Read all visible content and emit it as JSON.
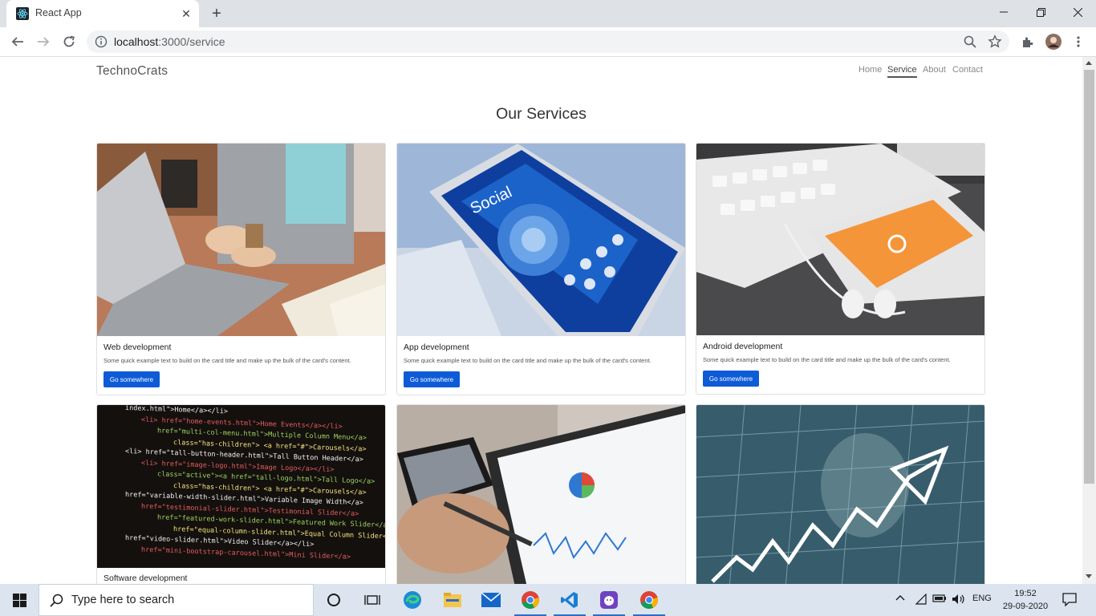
{
  "browser": {
    "tab_title": "React App",
    "url_host": "localhost",
    "url_path": ":3000/service",
    "window_controls": [
      "minimize-icon",
      "restore-icon",
      "close-icon"
    ]
  },
  "page": {
    "brand": "TechnoCrats",
    "nav": [
      {
        "label": "Home",
        "active": false
      },
      {
        "label": "Service",
        "active": true
      },
      {
        "label": "About",
        "active": false
      },
      {
        "label": "Contact",
        "active": false
      }
    ],
    "heading": "Our Services",
    "cards": [
      {
        "title": "Web development",
        "text": "Some quick example text to build on the card title and make up the bulk of the card's content.",
        "button": "Go somewhere",
        "image": "laptop-typing-photo"
      },
      {
        "title": "App development",
        "text": "Some quick example text to build on the card title and make up the bulk of the card's content.",
        "button": "Go somewhere",
        "image": "social-phone-photo"
      },
      {
        "title": "Android development",
        "text": "Some quick example text to build on the card title and make up the bulk of the card's content.",
        "button": "Go somewhere",
        "image": "android-phone-keyboard-photo"
      },
      {
        "title": "Software development",
        "text": "",
        "button": "",
        "image": "code-screen-photo"
      },
      {
        "title": "",
        "text": "",
        "button": "",
        "image": "tablet-analytics-photo"
      },
      {
        "title": "",
        "text": "",
        "button": "",
        "image": "stock-chart-photo"
      }
    ]
  },
  "code_lines": [
    "index.html\">Home</a></li>",
    "<li> href=\"home-events.html\">Home Events</a></li>",
    "href=\"multi-col-menu.html\">Multiple Column Menu</a>",
    "class=\"has-children\"> <a href=\"#\">Carousels</a>",
    "<li> href=\"tall-button-header.html\">Tall Button Header</a>",
    "<li> href=\"image-logo.html\">Image Logo</a></li>",
    "class=\"active\"><a href=\"tall-logo.html\">Tall Logo</a>",
    "class=\"has-children\"> <a href=\"#\">Carousels</a>",
    "href=\"variable-width-slider.html\">Variable Image Width</a>",
    "href=\"testimonial-slider.html\">Testimonial Slider</a>",
    "href=\"featured-work-slider.html\">Featured Work Slider</a>",
    "href=\"equal-column-slider.html\">Equal Column Slider</a>",
    "href=\"video-slider.html\">Video Slider</a></li>",
    "href=\"mini-bootstrap-carousel.html\">Mini Slider</a>"
  ],
  "taskbar": {
    "search_placeholder": "Type here to search",
    "language": "ENG",
    "time": "19:52",
    "date": "29-09-2020"
  },
  "colors": {
    "primary_button": "#0d5bd7",
    "taskbar_bg": "#dbe4ef",
    "tabstrip_bg": "#dee1e6"
  }
}
